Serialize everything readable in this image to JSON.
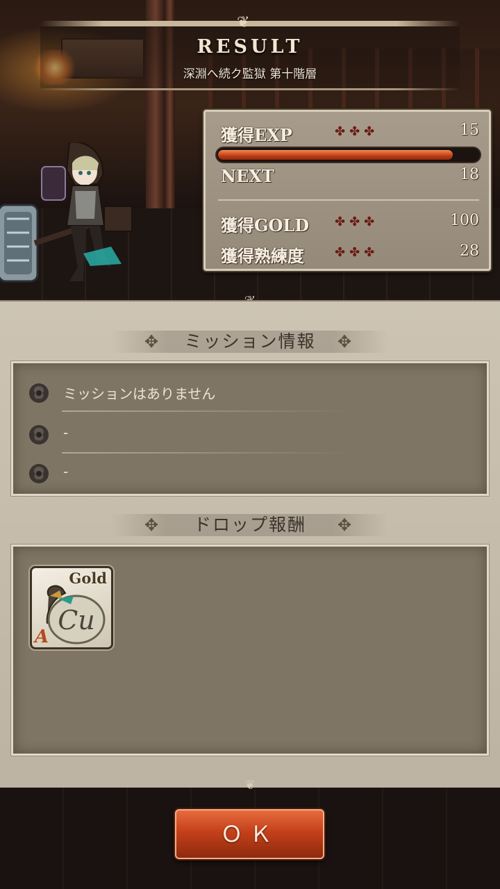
{
  "header": {
    "title": "RESULT",
    "stage": "深淵へ続ク監獄 第十階層"
  },
  "stats": {
    "exp_label": "獲得EXP",
    "exp_value": "15",
    "exp_progress": 0.9,
    "next_label": "NEXT",
    "next_value": "18",
    "gold_label": "獲得GOLD",
    "gold_value": "100",
    "proficiency_label": "獲得熟練度",
    "proficiency_value": "28",
    "dots": "✤✤✤"
  },
  "mission": {
    "title": "ミッション情報",
    "items": [
      "ミッションはありません",
      "-",
      "-"
    ]
  },
  "drops": {
    "title": "ドロップ報酬",
    "items": [
      {
        "label": "Gold",
        "rank": "A",
        "icon": "gold-bag-icon"
      }
    ]
  },
  "buttons": {
    "ok": "ＯＫ"
  },
  "colors": {
    "accent": "#c4401a",
    "exp_bar": "#e0602a",
    "parchment": "#c6bcac"
  }
}
